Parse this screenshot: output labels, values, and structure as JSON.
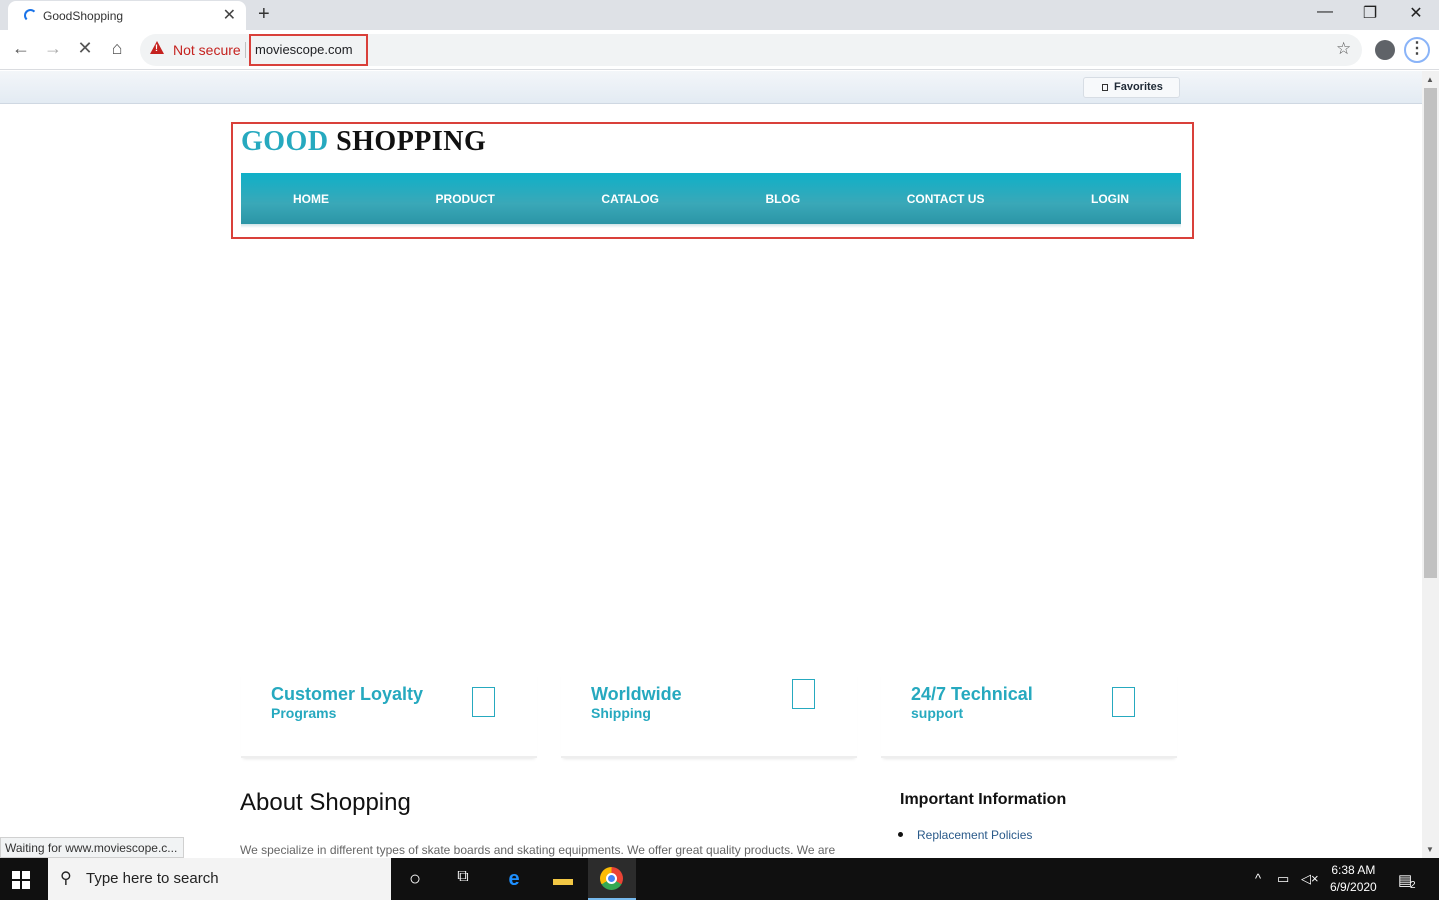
{
  "browser": {
    "tab_title": "GoodShopping",
    "tab_close": "✕",
    "new_tab": "+",
    "window_minimize": "—",
    "window_maximize": "❐",
    "window_close": "✕",
    "back_icon": "←",
    "forward_icon": "→",
    "stop_icon": "✕",
    "home_icon": "⌂",
    "security_label": "Not secure",
    "url": "moviescope.com",
    "bookmark_icon": "☆",
    "menu_icon": "⋮"
  },
  "favorites": {
    "label": "Favorites"
  },
  "site": {
    "logo_part1": "GOOD",
    "logo_part2": "SHOPPING",
    "nav": [
      "HOME",
      "PRODUCT",
      "CATALOG",
      "BLOG",
      "CONTACT US",
      "LOGIN"
    ],
    "features": [
      {
        "title": "Customer Loyalty",
        "subtitle": "Programs"
      },
      {
        "title": "Worldwide",
        "subtitle": "Shipping"
      },
      {
        "title": "24/7 Technical",
        "subtitle": "support"
      }
    ],
    "about_title": "About Shopping",
    "about_text": "We specialize in different types of skate boards and skating equipments. We offer great quality products. We are",
    "info_title": "Important Information",
    "info_links": [
      "Replacement Policies"
    ]
  },
  "status_text": "Waiting for www.moviescope.c...",
  "taskbar": {
    "search_placeholder": "Type here to search",
    "time": "6:38 AM",
    "date": "6/9/2020",
    "notification_count": "2"
  },
  "colors": {
    "accent": "#26a9bf",
    "highlight_box": "#d9403a"
  }
}
